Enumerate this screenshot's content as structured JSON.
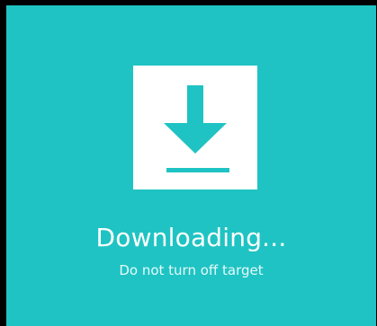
{
  "status": {
    "title": "Downloading...",
    "subtitle": "Do not turn off target"
  },
  "icon": {
    "name": "download-icon"
  },
  "colors": {
    "background": "#1fc3c3",
    "card": "#ffffff",
    "text": "#ffffff",
    "frame": "#000000"
  }
}
